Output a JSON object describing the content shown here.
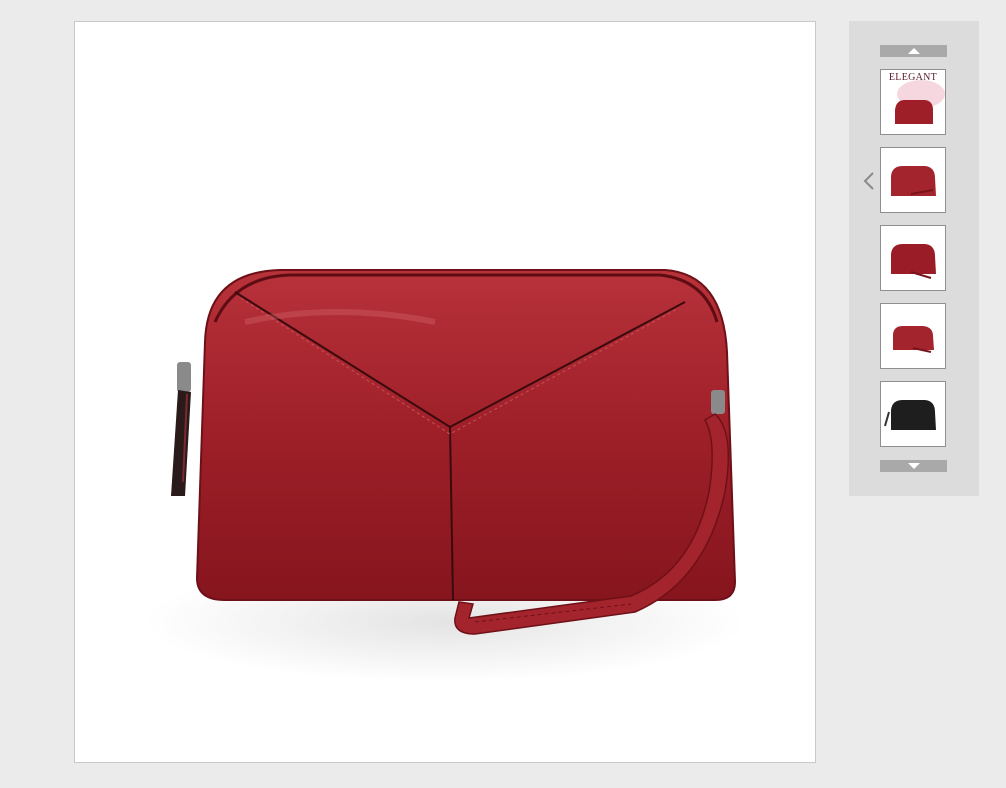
{
  "main_image": {
    "subject": "clutch-bag",
    "color": "#9e1f28"
  },
  "thumbnails": {
    "scroll_up_icon": "triangle-up-icon",
    "scroll_down_icon": "triangle-down-icon",
    "prev_icon": "chevron-left-icon",
    "items": [
      {
        "caption": "ELEGANT",
        "color": "#9e1f28"
      },
      {
        "color": "#a4242d"
      },
      {
        "color": "#9a1c26"
      },
      {
        "color": "#a4242d"
      },
      {
        "color": "#1e1e1e"
      }
    ]
  }
}
